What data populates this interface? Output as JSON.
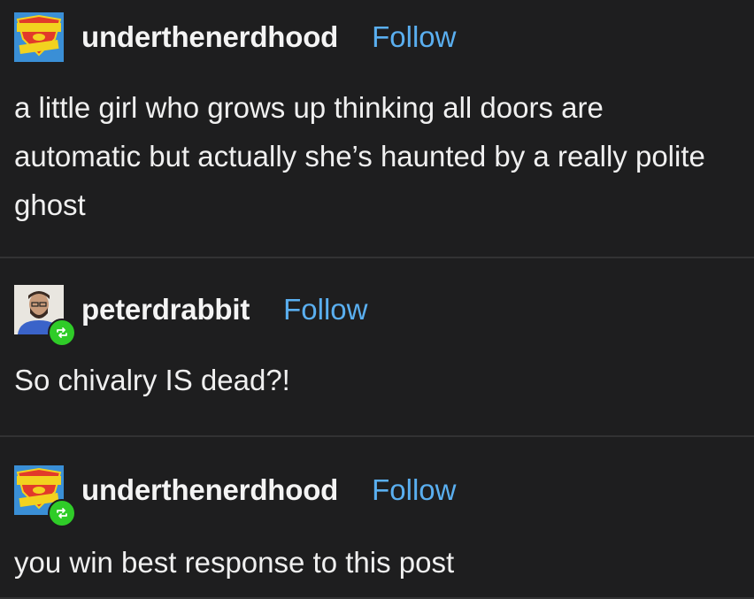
{
  "posts": [
    {
      "username": "underthenerdhood",
      "follow_label": "Follow",
      "avatar_icon": "super-friends-benefits-logo-icon",
      "avatar_text": "SUPER FRIENDS BENEFITS",
      "reblogged": false,
      "text": "a little girl who grows up thinking all doors are automatic but actually she’s haunted by a really polite ghost"
    },
    {
      "username": "peterdrabbit",
      "follow_label": "Follow",
      "avatar_icon": "user-photo-icon",
      "reblogged": true,
      "text": "So chivalry IS dead?!"
    },
    {
      "username": "underthenerdhood",
      "follow_label": "Follow",
      "avatar_icon": "super-friends-benefits-logo-icon",
      "avatar_text": "SUPER FRIENDS BENEFITS",
      "reblogged": true,
      "text": "you win best response to this post"
    }
  ],
  "colors": {
    "background": "#1e1e1f",
    "follow": "#5aaff0",
    "reblog_badge": "#2fcc28",
    "divider": "#323233"
  }
}
